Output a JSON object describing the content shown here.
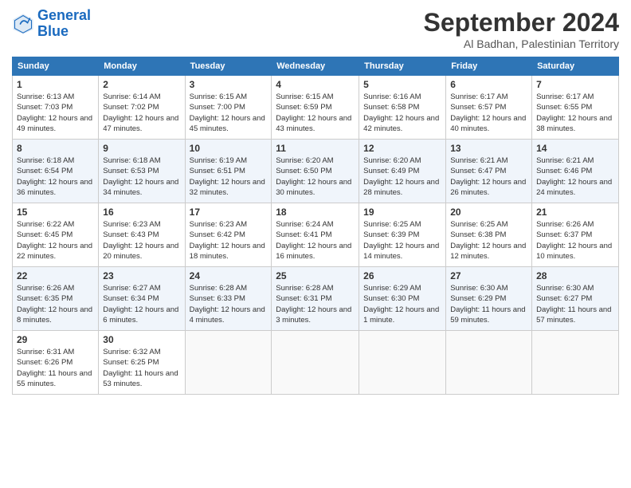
{
  "header": {
    "logo_line1": "General",
    "logo_line2": "Blue",
    "month": "September 2024",
    "location": "Al Badhan, Palestinian Territory"
  },
  "days_of_week": [
    "Sunday",
    "Monday",
    "Tuesday",
    "Wednesday",
    "Thursday",
    "Friday",
    "Saturday"
  ],
  "weeks": [
    [
      {
        "day": "1",
        "sunrise": "6:13 AM",
        "sunset": "7:03 PM",
        "daylight": "12 hours and 49 minutes."
      },
      {
        "day": "2",
        "sunrise": "6:14 AM",
        "sunset": "7:02 PM",
        "daylight": "12 hours and 47 minutes."
      },
      {
        "day": "3",
        "sunrise": "6:15 AM",
        "sunset": "7:00 PM",
        "daylight": "12 hours and 45 minutes."
      },
      {
        "day": "4",
        "sunrise": "6:15 AM",
        "sunset": "6:59 PM",
        "daylight": "12 hours and 43 minutes."
      },
      {
        "day": "5",
        "sunrise": "6:16 AM",
        "sunset": "6:58 PM",
        "daylight": "12 hours and 42 minutes."
      },
      {
        "day": "6",
        "sunrise": "6:17 AM",
        "sunset": "6:57 PM",
        "daylight": "12 hours and 40 minutes."
      },
      {
        "day": "7",
        "sunrise": "6:17 AM",
        "sunset": "6:55 PM",
        "daylight": "12 hours and 38 minutes."
      }
    ],
    [
      {
        "day": "8",
        "sunrise": "6:18 AM",
        "sunset": "6:54 PM",
        "daylight": "12 hours and 36 minutes."
      },
      {
        "day": "9",
        "sunrise": "6:18 AM",
        "sunset": "6:53 PM",
        "daylight": "12 hours and 34 minutes."
      },
      {
        "day": "10",
        "sunrise": "6:19 AM",
        "sunset": "6:51 PM",
        "daylight": "12 hours and 32 minutes."
      },
      {
        "day": "11",
        "sunrise": "6:20 AM",
        "sunset": "6:50 PM",
        "daylight": "12 hours and 30 minutes."
      },
      {
        "day": "12",
        "sunrise": "6:20 AM",
        "sunset": "6:49 PM",
        "daylight": "12 hours and 28 minutes."
      },
      {
        "day": "13",
        "sunrise": "6:21 AM",
        "sunset": "6:47 PM",
        "daylight": "12 hours and 26 minutes."
      },
      {
        "day": "14",
        "sunrise": "6:21 AM",
        "sunset": "6:46 PM",
        "daylight": "12 hours and 24 minutes."
      }
    ],
    [
      {
        "day": "15",
        "sunrise": "6:22 AM",
        "sunset": "6:45 PM",
        "daylight": "12 hours and 22 minutes."
      },
      {
        "day": "16",
        "sunrise": "6:23 AM",
        "sunset": "6:43 PM",
        "daylight": "12 hours and 20 minutes."
      },
      {
        "day": "17",
        "sunrise": "6:23 AM",
        "sunset": "6:42 PM",
        "daylight": "12 hours and 18 minutes."
      },
      {
        "day": "18",
        "sunrise": "6:24 AM",
        "sunset": "6:41 PM",
        "daylight": "12 hours and 16 minutes."
      },
      {
        "day": "19",
        "sunrise": "6:25 AM",
        "sunset": "6:39 PM",
        "daylight": "12 hours and 14 minutes."
      },
      {
        "day": "20",
        "sunrise": "6:25 AM",
        "sunset": "6:38 PM",
        "daylight": "12 hours and 12 minutes."
      },
      {
        "day": "21",
        "sunrise": "6:26 AM",
        "sunset": "6:37 PM",
        "daylight": "12 hours and 10 minutes."
      }
    ],
    [
      {
        "day": "22",
        "sunrise": "6:26 AM",
        "sunset": "6:35 PM",
        "daylight": "12 hours and 8 minutes."
      },
      {
        "day": "23",
        "sunrise": "6:27 AM",
        "sunset": "6:34 PM",
        "daylight": "12 hours and 6 minutes."
      },
      {
        "day": "24",
        "sunrise": "6:28 AM",
        "sunset": "6:33 PM",
        "daylight": "12 hours and 4 minutes."
      },
      {
        "day": "25",
        "sunrise": "6:28 AM",
        "sunset": "6:31 PM",
        "daylight": "12 hours and 3 minutes."
      },
      {
        "day": "26",
        "sunrise": "6:29 AM",
        "sunset": "6:30 PM",
        "daylight": "12 hours and 1 minute."
      },
      {
        "day": "27",
        "sunrise": "6:30 AM",
        "sunset": "6:29 PM",
        "daylight": "11 hours and 59 minutes."
      },
      {
        "day": "28",
        "sunrise": "6:30 AM",
        "sunset": "6:27 PM",
        "daylight": "11 hours and 57 minutes."
      }
    ],
    [
      {
        "day": "29",
        "sunrise": "6:31 AM",
        "sunset": "6:26 PM",
        "daylight": "11 hours and 55 minutes."
      },
      {
        "day": "30",
        "sunrise": "6:32 AM",
        "sunset": "6:25 PM",
        "daylight": "11 hours and 53 minutes."
      },
      null,
      null,
      null,
      null,
      null
    ]
  ]
}
